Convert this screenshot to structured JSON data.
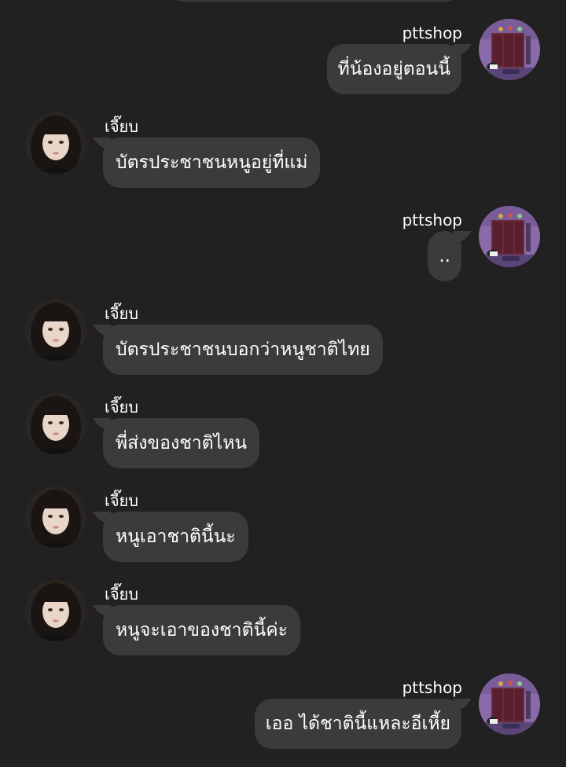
{
  "colors": {
    "background": "#212121",
    "bubble": "#3b3b3b",
    "text": "#ffffff"
  },
  "messages": [
    {
      "side": "out",
      "sender": "pttshop",
      "text": "ที่น้องอยู่ตอนนี้",
      "avatar_icon": "shop-room-avatar-icon"
    },
    {
      "side": "in",
      "sender": "เจี๊ยบ",
      "text": "บัตรประชาชนหนูอยู่ที่แม่",
      "avatar_icon": "girl-portrait-avatar-icon"
    },
    {
      "side": "out",
      "sender": "pttshop",
      "text": "..",
      "avatar_icon": "shop-room-avatar-icon"
    },
    {
      "side": "in",
      "sender": "เจี๊ยบ",
      "text": "บัตรประชาชนบอกว่าหนูชาติไทย",
      "avatar_icon": "girl-portrait-avatar-icon"
    },
    {
      "side": "in",
      "sender": "เจี๊ยบ",
      "text": "พี่ส่งของชาติไหน",
      "avatar_icon": "girl-portrait-avatar-icon"
    },
    {
      "side": "in",
      "sender": "เจี๊ยบ",
      "text": "หนูเอาชาตินี้นะ",
      "avatar_icon": "girl-portrait-avatar-icon"
    },
    {
      "side": "in",
      "sender": "เจี๊ยบ",
      "text": "หนูจะเอาของชาตินี้ค่ะ",
      "avatar_icon": "girl-portrait-avatar-icon"
    },
    {
      "side": "out",
      "sender": "pttshop",
      "text": "เออ ได้ชาตินี้แหละอีเหี้ย",
      "avatar_icon": "shop-room-avatar-icon"
    }
  ]
}
